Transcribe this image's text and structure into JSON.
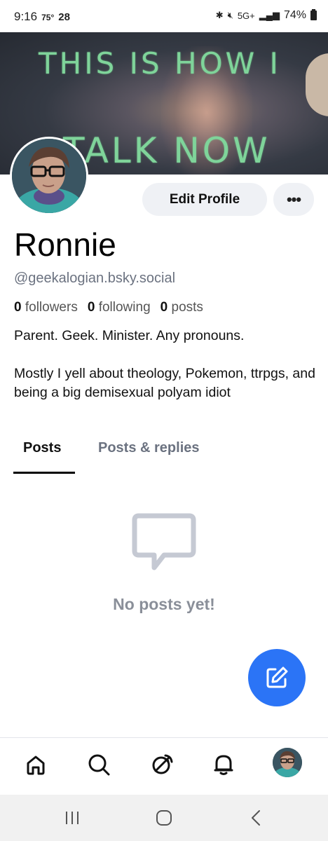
{
  "status_bar": {
    "time": "9:16",
    "temperature": "75°",
    "extra_number": "28",
    "network": "5G+",
    "battery": "74%"
  },
  "banner": {
    "line1": "THIS IS HOW I",
    "line2": "TALK NOW"
  },
  "profile": {
    "display_name": "Ronnie",
    "handle": "@geekalogian.bsky.social",
    "followers_count": "0",
    "followers_label": "followers",
    "following_count": "0",
    "following_label": "following",
    "posts_count": "0",
    "posts_label": "posts",
    "bio_line1": "Parent. Geek. Minister. Any pronouns.",
    "bio_line2": "Mostly I yell about theology, Pokemon, ttrpgs, and being a big demisexual polyam idiot"
  },
  "actions": {
    "edit_profile_label": "Edit Profile",
    "more_label": "•••"
  },
  "tabs": [
    {
      "label": "Posts",
      "selected": true
    },
    {
      "label": "Posts & replies",
      "selected": false
    }
  ],
  "empty_state": {
    "message": "No posts yet!",
    "icon": "message-bubble-icon"
  },
  "fab": {
    "icon": "compose-icon",
    "color": "#2b74f6"
  },
  "bottom_nav": [
    {
      "icon": "home-icon"
    },
    {
      "icon": "search-icon"
    },
    {
      "icon": "feeds-icon"
    },
    {
      "icon": "notifications-icon"
    },
    {
      "icon": "profile-avatar"
    }
  ],
  "system_nav": [
    {
      "icon": "recents-icon"
    },
    {
      "icon": "home-circle-icon"
    },
    {
      "icon": "back-icon"
    }
  ],
  "colors": {
    "accent": "#2b74f6",
    "muted_text": "#6b7280",
    "button_bg": "#eff1f5"
  }
}
